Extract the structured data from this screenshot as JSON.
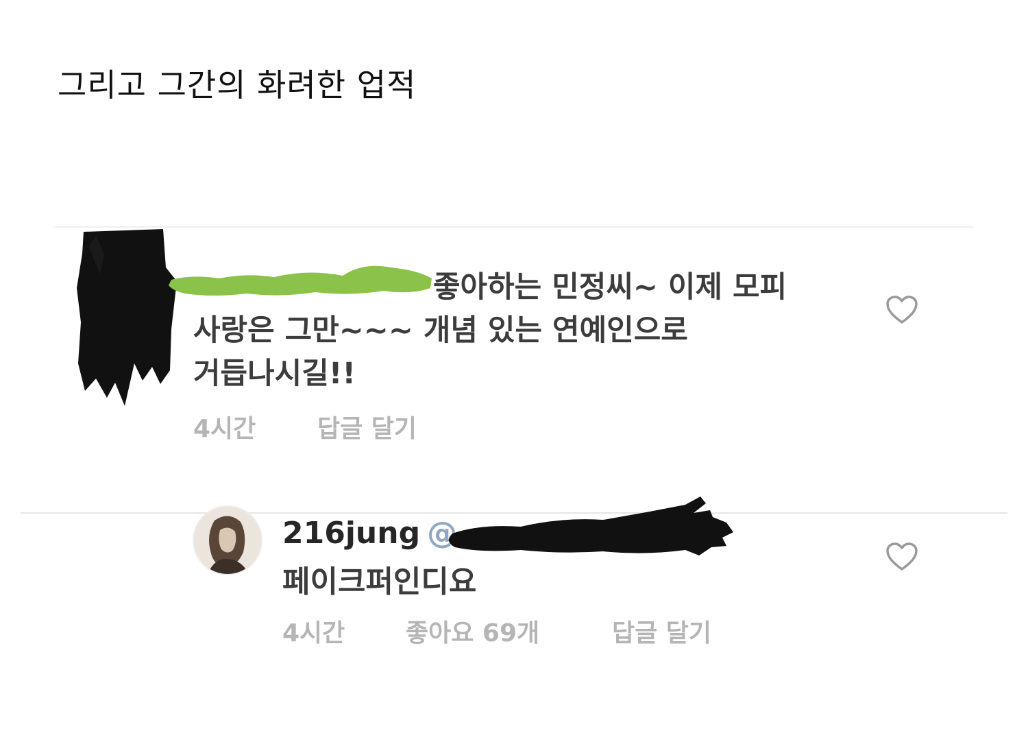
{
  "caption": "그리고 그간의 화려한 업적",
  "comment1": {
    "line1": "좋아하는 민정씨~ 이제 모피",
    "line2": "사랑은 그만~~~ 개념 있는 연예인으로",
    "line3": "거듭나시길!!",
    "time": "4시간",
    "reply": "답글 달기"
  },
  "comment2": {
    "username": "216jung",
    "mention": "@",
    "text": "페이크퍼인디요",
    "time": "4시간",
    "likes": "좋아요 69개",
    "reply": "답글 달기"
  },
  "icons": {
    "like": "heart-outline-icon"
  },
  "colors": {
    "redaction_green": "#8bc34a",
    "redaction_black": "#111111",
    "meta_gray": "#b5b5b5",
    "mention_blue": "#8fa7c2"
  }
}
